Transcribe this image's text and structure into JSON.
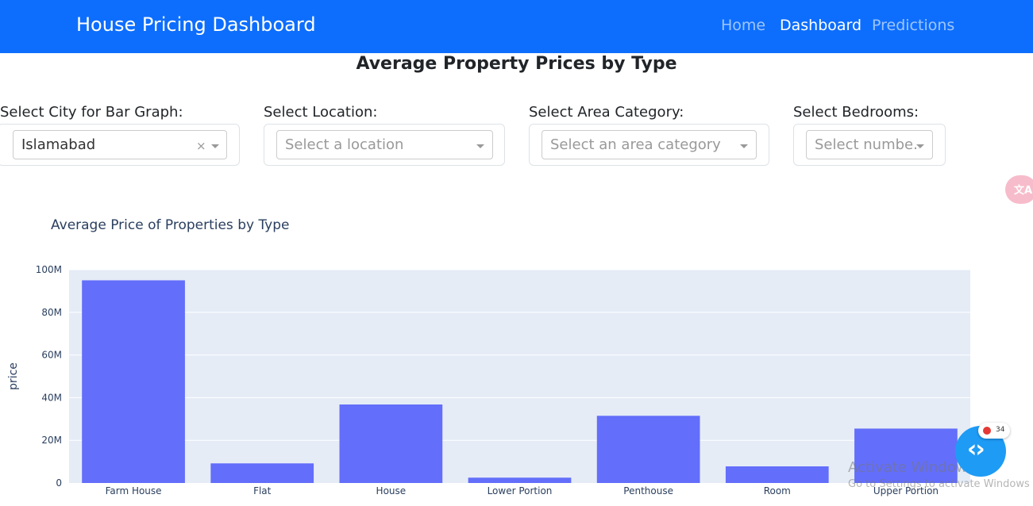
{
  "navbar": {
    "brand": "House Pricing Dashboard",
    "links": [
      "Home",
      "Dashboard",
      "Predictions"
    ],
    "active": "Dashboard",
    "color": "#0d6efd"
  },
  "page_title": "Average Property Prices by Type",
  "filters": [
    {
      "label": "Select City for Bar Graph:",
      "value": "Islamabad",
      "placeholder": ""
    },
    {
      "label": "Select Location:",
      "value": "",
      "placeholder": "Select a location"
    },
    {
      "label": "Select Area Category:",
      "value": "",
      "placeholder": "Select an area category"
    },
    {
      "label": "Select Bedrooms:",
      "value": "",
      "placeholder": "Select numbe..."
    }
  ],
  "translate_icon": {
    "name": "translate-icon",
    "glyph": "文A"
  },
  "chart_data": {
    "type": "bar",
    "title": "Average Price of Properties by Type",
    "xlabel": "",
    "ylabel": "price",
    "categories": [
      "Farm House",
      "Flat",
      "House",
      "Lower Portion",
      "Penthouse",
      "Room",
      "Upper Portion"
    ],
    "values": [
      95000000,
      9200000,
      36800000,
      2500000,
      31500000,
      7800000,
      25500000
    ],
    "ylim": [
      0,
      100000000
    ],
    "yticks": [
      "0",
      "20M",
      "40M",
      "60M",
      "80M",
      "100M"
    ],
    "bar_color": "#636efa",
    "plot_bg": "#e5ecf6",
    "grid": true
  },
  "watermark": {
    "line1": "Activate Windows",
    "line2": "Go to Settings to activate Windows"
  },
  "fab": {
    "icon": "code-arrows-icon",
    "glyph": "‹›",
    "color": "#1e9bf5"
  },
  "badge": {
    "count": "34",
    "color": "#e53935"
  }
}
